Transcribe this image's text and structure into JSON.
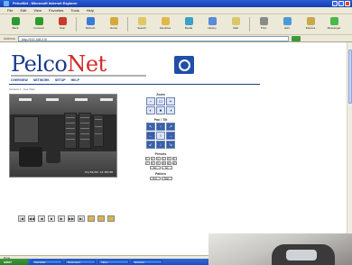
{
  "window": {
    "title": "PelcoNet - Microsoft Internet Explorer"
  },
  "menu": [
    "File",
    "Edit",
    "View",
    "Favorites",
    "Tools",
    "Help"
  ],
  "toolbar": {
    "buttons": [
      {
        "label": "Back",
        "icon": "back-arrow-icon",
        "color": "#2e9a2e"
      },
      {
        "label": "Forward",
        "icon": "forward-arrow-icon",
        "color": "#2e9a2e"
      },
      {
        "label": "Stop",
        "icon": "stop-icon",
        "color": "#c83a2a"
      },
      {
        "label": "Refresh",
        "icon": "refresh-icon",
        "color": "#3a7ad8"
      },
      {
        "label": "Home",
        "icon": "home-icon",
        "color": "#d8a83a"
      },
      {
        "label": "Search",
        "icon": "search-icon",
        "color": "#e2c860"
      },
      {
        "label": "Favorites",
        "icon": "star-icon",
        "color": "#e0b84a"
      },
      {
        "label": "Media",
        "icon": "media-icon",
        "color": "#3aa0c8"
      },
      {
        "label": "History",
        "icon": "history-icon",
        "color": "#5a8ad8"
      },
      {
        "label": "Mail",
        "icon": "mail-icon",
        "color": "#d8c86a"
      },
      {
        "label": "Print",
        "icon": "print-icon",
        "color": "#8a8a8a"
      },
      {
        "label": "Edit",
        "icon": "edit-icon",
        "color": "#4a9ad8"
      },
      {
        "label": "Discuss",
        "icon": "discuss-icon",
        "color": "#c8a84a"
      },
      {
        "label": "Messenger",
        "icon": "messenger-icon",
        "color": "#4ab84a"
      }
    ]
  },
  "address": {
    "label": "Address",
    "value": "http://192.168.0.5/"
  },
  "page": {
    "logo_part1": "Pelco",
    "logo_part2": "Net",
    "nav": [
      "OVERVIEW",
      "NETWORK",
      "SETUP",
      "HELP"
    ],
    "subline": "Camera 1 - Live View",
    "camera_timestamp": "01/01/04 12:00:00"
  },
  "controls": {
    "zoom_title": "Zoom",
    "pan_tilt_title": "Pan / Tilt",
    "presets_title": "Presets",
    "pattern_title": "Pattern",
    "set_label": "Set",
    "go_label": "Go",
    "run_label": "Run",
    "stop_label": "Stop",
    "presets_row1": [
      "1",
      "2",
      "3",
      "4",
      "5",
      "6"
    ],
    "presets_row2": [
      "7",
      "8",
      "9",
      "10",
      "11",
      "12"
    ]
  },
  "playbar": [
    "|◀",
    "◀◀",
    "◀",
    "■",
    "▶",
    "▶▶",
    "▶|"
  ],
  "status": {
    "text": "Done"
  },
  "taskbar": {
    "start_label": "start",
    "items": [
      "PelcoNet",
      "Document",
      "Inbox",
      "Explorer"
    ]
  },
  "colors": {
    "brand_blue": "#1a3a8a",
    "brand_red": "#d22a2a",
    "xp_blue": "#2a5ad6"
  }
}
